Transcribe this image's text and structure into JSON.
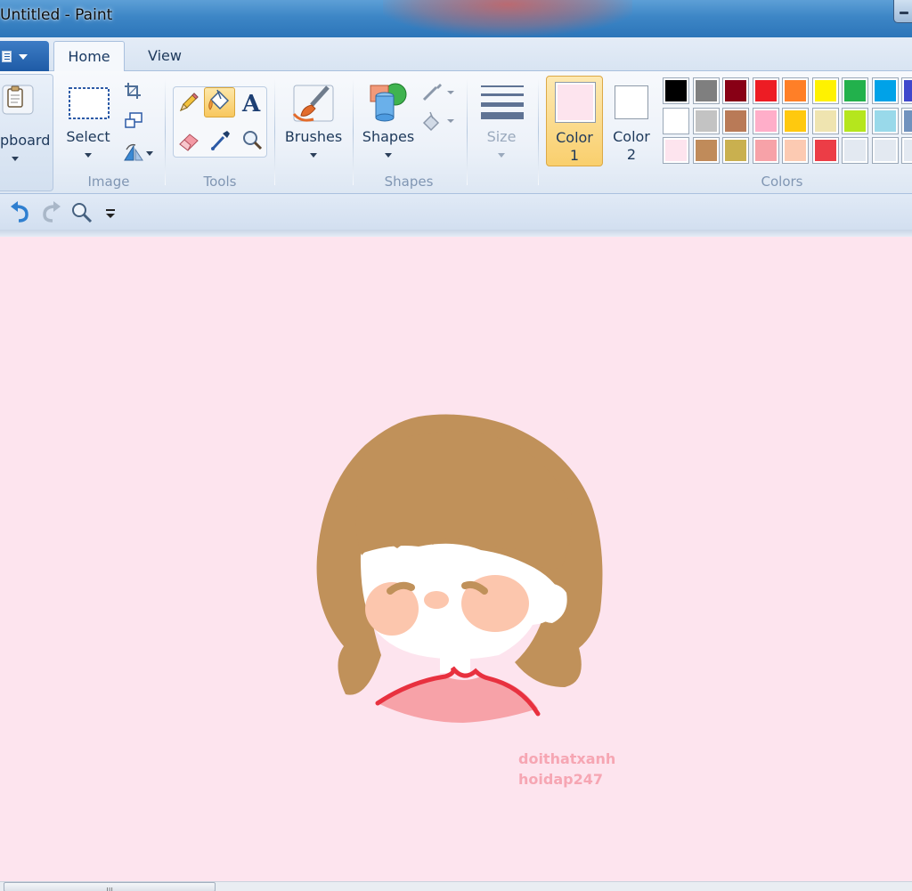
{
  "window": {
    "title": "Untitled - Paint"
  },
  "tabs": [
    {
      "label": "Home"
    },
    {
      "label": "View"
    }
  ],
  "ribbon": {
    "clipboard": {
      "label": "pboard"
    },
    "image": {
      "select_label": "Select",
      "group_label": "Image"
    },
    "tools": {
      "group_label": "Tools"
    },
    "brushes": {
      "label": "Brushes"
    },
    "shapes": {
      "label": "Shapes",
      "group_label": "Shapes"
    },
    "size": {
      "label": "Size"
    },
    "color1": {
      "line1": "Color",
      "line2": "1",
      "value": "#fde4ee"
    },
    "color2": {
      "line1": "Color",
      "line2": "2",
      "value": "#ffffff"
    },
    "colors": {
      "group_label": "Colors",
      "palette": [
        [
          "#000000",
          "#7f7f7f",
          "#880015",
          "#ed1c24",
          "#ff7f27",
          "#fff200",
          "#22b14c",
          "#00a2e8",
          "#3f48cc"
        ],
        [
          "#ffffff",
          "#c3c3c3",
          "#b97a57",
          "#ffaec9",
          "#ffc90e",
          "#efe4b0",
          "#b5e61d",
          "#99d9ea",
          "#7092be"
        ],
        [
          "#fde4ee",
          "#c08b5a",
          "#c9b04f",
          "#f7a2a8",
          "#fccab2",
          "#ec3d46",
          "#e3e9f1",
          "#e3e9f1",
          "#e3e9f1"
        ]
      ]
    }
  },
  "canvas": {
    "background": "#fde4ee",
    "watermark_line1": "doithatxanh",
    "watermark_line2": "hoidap247",
    "colors": {
      "hair": "#c0915a",
      "skin": "#ffffff",
      "blush": "#fcc6ad",
      "shirt": "#f7a2a8",
      "collar": "#e8313f"
    }
  },
  "scrollbar": {
    "grip": "|||"
  }
}
